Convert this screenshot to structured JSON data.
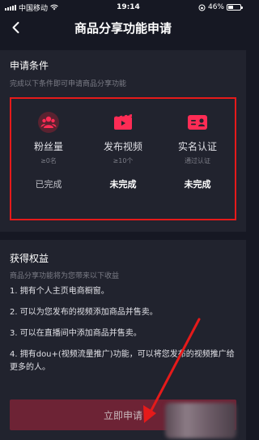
{
  "status_bar": {
    "carrier": "中国移动",
    "time": "19:14",
    "battery": "46%",
    "battery_level": 0.46
  },
  "nav": {
    "title": "商品分享功能申请",
    "back_icon": "chevron-left-icon"
  },
  "requirements": {
    "title": "申请条件",
    "subtitle": "完成以下条件即可申请商品分享功能",
    "items": [
      {
        "icon": "fans-icon",
        "name": "粉丝量",
        "detail": "≥0名",
        "status": "已完成",
        "completed": true
      },
      {
        "icon": "video-icon",
        "name": "发布视频",
        "detail": "≥10个",
        "status": "未完成",
        "completed": false
      },
      {
        "icon": "id-card-icon",
        "name": "实名认证",
        "detail": "通过认证",
        "status": "未完成",
        "completed": false
      }
    ]
  },
  "benefits": {
    "title": "获得权益",
    "subtitle": "商品分享功能将为您带来以下收益",
    "items": [
      "1. 拥有个人主页电商橱窗。",
      "2. 可以为您发布的视频添加商品并售卖。",
      "3. 可以在直播间中添加商品并售卖。",
      "4. 拥有dou+(视频流量推广)功能，可以将您发布的视频推广给更多的人。"
    ]
  },
  "apply_button": {
    "label": "立即申请"
  },
  "colors": {
    "background": "#161823",
    "panel": "#21232e",
    "accent": "#fe2c55",
    "highlight_box": "#e51a1a",
    "button": "#6d2335"
  }
}
